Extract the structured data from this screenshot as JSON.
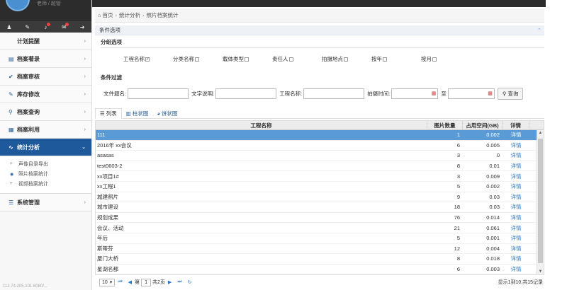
{
  "sidebar": {
    "user_text": "老师 / 超管",
    "icons": [
      "user-icon",
      "edit-icon",
      "bell-icon",
      "mail-icon",
      "logout-icon"
    ],
    "menu": [
      {
        "label": "计划提醒",
        "icon": ""
      },
      {
        "label": "档案著录",
        "icon": "▤"
      },
      {
        "label": "档案审核",
        "icon": "✔"
      },
      {
        "label": "库存修改",
        "icon": "✎"
      },
      {
        "label": "档案查询",
        "icon": "⚲"
      },
      {
        "label": "档案利用",
        "icon": "▦"
      },
      {
        "label": "统计分析",
        "icon": "∿"
      }
    ],
    "sub_items": [
      "声像目录导出",
      "照片档案统计",
      "视频档案统计"
    ],
    "system": "系统管理",
    "status": "112.74.205.101:8080/..."
  },
  "breadcrumb": {
    "home": "首页",
    "level1": "统计分析",
    "level2": "照片档案统计"
  },
  "conditions": {
    "header": "条件选项",
    "group_title": "分组选项",
    "checkboxes": [
      "工程名称",
      "分类名称",
      "载体类型",
      "责任人",
      "拍摄地点",
      "按年",
      "按月"
    ],
    "filter_title": "条件过滤",
    "file_title_label": "文件题名:",
    "text_desc_label": "文字说明:",
    "project_label": "工程名称:",
    "shoot_time_label": "拍摄时间:",
    "to_label": "至",
    "query_button": "查询"
  },
  "tabs": [
    "列表",
    "柱状图",
    "饼状图"
  ],
  "table": {
    "headers": [
      "工程名称",
      "图片数量",
      "占用空间(GB)",
      "详情"
    ],
    "rows": [
      {
        "name": "111",
        "count": "1",
        "size": "0.002",
        "detail": "详情"
      },
      {
        "name": "2016年 xx会议",
        "count": "6",
        "size": "0.005",
        "detail": "详情"
      },
      {
        "name": "asasas",
        "count": "3",
        "size": "0",
        "detail": "详情"
      },
      {
        "name": "test0603-2",
        "count": "8",
        "size": "0.01",
        "detail": "详情"
      },
      {
        "name": "xx项目1#",
        "count": "3",
        "size": "0.009",
        "detail": "详情"
      },
      {
        "name": "xx工程1",
        "count": "5",
        "size": "0.002",
        "detail": "详情"
      },
      {
        "name": "城建照片",
        "count": "9",
        "size": "0.03",
        "detail": "详情"
      },
      {
        "name": "城市建设",
        "count": "18",
        "size": "0.03",
        "detail": "详情"
      },
      {
        "name": "规划成果",
        "count": "76",
        "size": "0.014",
        "detail": "详情"
      },
      {
        "name": "会议、活动",
        "count": "21",
        "size": "0.061",
        "detail": "详情"
      },
      {
        "name": "年后",
        "count": "5",
        "size": "0.001",
        "detail": "详情"
      },
      {
        "name": "斯蒂芬",
        "count": "12",
        "size": "0.004",
        "detail": "详情"
      },
      {
        "name": "厦门大桥",
        "count": "8",
        "size": "0.018",
        "detail": "详情"
      },
      {
        "name": "星湖名都",
        "count": "6",
        "size": "0.003",
        "detail": "详情"
      }
    ]
  },
  "pager": {
    "page_size": "10",
    "page_label": "第",
    "page": "1",
    "total_pages": "共2页",
    "info": "显示1到10,共15记录"
  }
}
